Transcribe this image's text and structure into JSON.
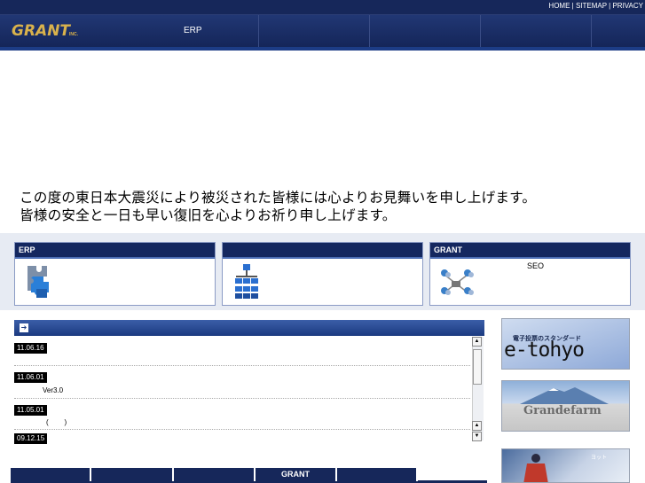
{
  "header": {
    "utility_links": [
      "HOME",
      "SITEMAP",
      "PRIVACY"
    ],
    "utility_sep": " | ",
    "logo_text": "GRANT",
    "logo_suffix": "INC.",
    "nav_items": [
      "ERP",
      "",
      "",
      "",
      ""
    ]
  },
  "message": {
    "line1": "この度の東日本大震災により被災された皆様には心よりお見舞いを申し上げます。",
    "line2": "皆様の安全と一日も早い復旧を心よりお祈り申し上げます。"
  },
  "panels": [
    {
      "title": "ERP",
      "text": "",
      "icon": "puzzle-icon"
    },
    {
      "title": "",
      "text": "",
      "icon": "network-diagram-icon"
    },
    {
      "title": "GRANT",
      "text": "SEO",
      "icon": "people-network-icon"
    }
  ],
  "news": {
    "header_icon": "arrow-icon",
    "items": [
      {
        "date": "11.06.16",
        "text": ""
      },
      {
        "date": "11.06.01",
        "text": "Ver3.0"
      },
      {
        "date": "11.05.01",
        "text": "(        )"
      },
      {
        "date": "09.12.15",
        "text": ""
      }
    ]
  },
  "bottom_tabs": [
    "",
    "",
    "",
    "GRANT",
    ""
  ],
  "banners": [
    {
      "name": "e-tohyo",
      "caption": "電子投票のスタンダード",
      "logo": "e-tohyo"
    },
    {
      "name": "grandefarm",
      "logo": "Grandefarm"
    },
    {
      "name": "sailing",
      "caption": "ヨット"
    }
  ],
  "colors": {
    "header_bg": "#16275a",
    "logo": "#d9b24c",
    "accent": "#1c3c86",
    "band": "#e7ebf3"
  }
}
